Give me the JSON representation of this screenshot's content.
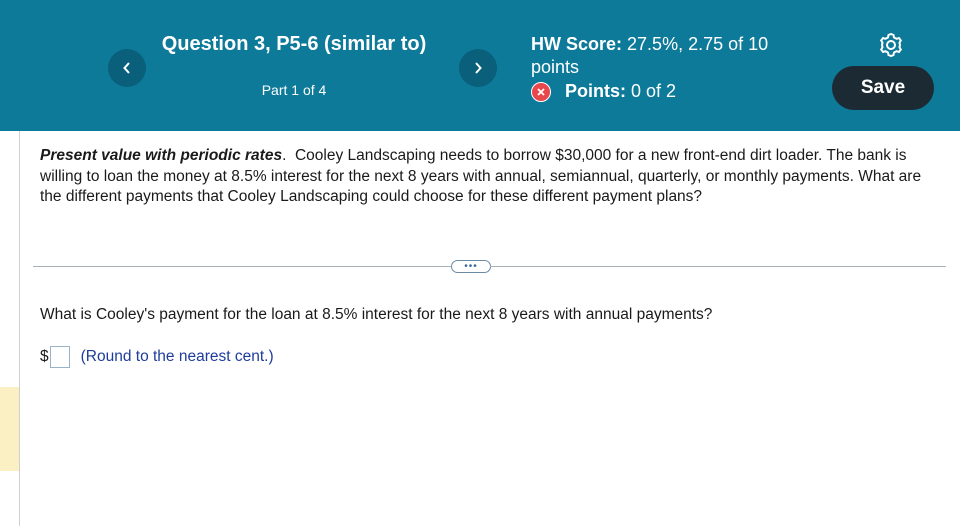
{
  "header": {
    "question_title": "Question 3, P5-6 (similar to)",
    "part": "Part 1 of 4",
    "hw_score_label": "HW Score:",
    "hw_score_value": "27.5%, 2.75 of 10",
    "hw_score_unit": "points",
    "points_label": "Points:",
    "points_value": "0 of 2",
    "save_label": "Save",
    "colors": {
      "banner": "#0d7a9a",
      "nav_button": "#0a5f7a",
      "save_button": "#1c2a33",
      "error_badge": "#e8474c"
    },
    "icons": {
      "prev": "chevron-left-icon",
      "next": "chevron-right-icon",
      "settings": "gear-icon",
      "status": "x-circle-icon"
    }
  },
  "problem": {
    "title": "Present value with periodic rates",
    "body": "Cooley Landscaping needs to borrow $30,000 for a new front-end dirt loader. The bank is willing to loan the money at 8.5% interest for the next 8 years with annual, semiannual, quarterly, or monthly payments.  What are the different payments that Cooley Landscaping could choose for these different payment plans?"
  },
  "more_button": {
    "label": "•••"
  },
  "question": {
    "text": "What is Cooley's payment for the loan at 8.5% interest for the next 8 years with annual payments?",
    "currency": "$",
    "answer_value": "",
    "hint": "(Round to the nearest cent.)"
  }
}
